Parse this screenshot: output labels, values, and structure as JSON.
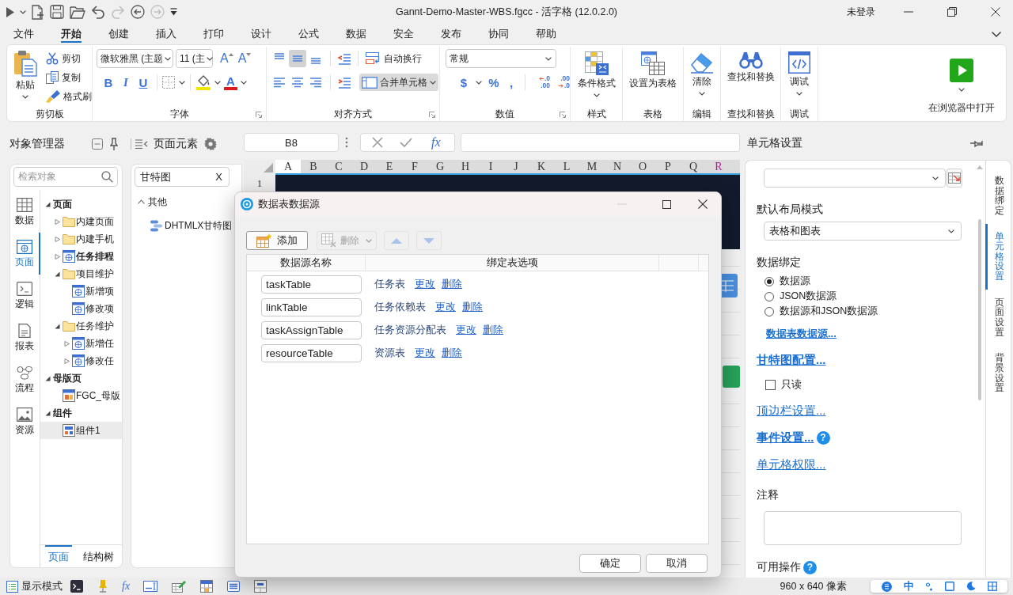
{
  "title_bar": {
    "quick_access": [
      {
        "kind": "run",
        "disabled": false
      },
      {
        "kind": "new",
        "disabled": false
      },
      {
        "kind": "save",
        "disabled": false
      },
      {
        "kind": "open",
        "disabled": false
      },
      {
        "kind": "undo",
        "disabled": false
      },
      {
        "kind": "redo",
        "disabled": true
      },
      {
        "kind": "back",
        "disabled": false
      },
      {
        "kind": "forward",
        "disabled": true
      }
    ],
    "title": "Gannt-Demo-Master-WBS.fgcc - 活字格 (12.0.2.0)",
    "account": "未登录"
  },
  "menu_tabs": [
    {
      "label": "文件",
      "selected": false
    },
    {
      "label": "开始",
      "selected": true
    },
    {
      "label": "创建",
      "selected": false
    },
    {
      "label": "插入",
      "selected": false
    },
    {
      "label": "打印",
      "selected": false
    },
    {
      "label": "设计",
      "selected": false
    },
    {
      "label": "公式",
      "selected": false
    },
    {
      "label": "数据",
      "selected": false
    },
    {
      "label": "安全",
      "selected": false
    },
    {
      "label": "发布",
      "selected": false
    },
    {
      "label": "协同",
      "selected": false
    },
    {
      "label": "帮助",
      "selected": false
    }
  ],
  "ribbon": {
    "groups": [
      {
        "kind": "clipboard",
        "label": "剪切板",
        "paste": "粘贴",
        "actions": [
          {
            "kind": "cut",
            "label": "剪切"
          },
          {
            "kind": "copy",
            "label": "复制"
          },
          {
            "kind": "format-painter",
            "label": "格式刷"
          }
        ]
      },
      {
        "kind": "font",
        "label": "字体",
        "dialog_launcher": true,
        "font": "微软雅黑 (主题",
        "size": "11 (主",
        "grow": "A",
        "shrink": "A",
        "styles": [
          {
            "kind": "bold",
            "label": "B"
          },
          {
            "kind": "italic",
            "label": "I"
          },
          {
            "kind": "underline",
            "label": "U"
          }
        ],
        "font_color": "A"
      },
      {
        "kind": "alignment",
        "label": "对齐方式",
        "dialog_launcher": true,
        "vertical": [
          {
            "kind": "top",
            "selected": false
          },
          {
            "kind": "middle",
            "selected": true
          },
          {
            "kind": "bottom",
            "selected": false
          }
        ],
        "horizontal": [
          {
            "kind": "left",
            "selected": false
          },
          {
            "kind": "center",
            "selected": false
          },
          {
            "kind": "right",
            "selected": false
          }
        ],
        "wrap": {
          "label": "自动换行",
          "on": false
        },
        "merge": {
          "label": "合并单元格",
          "on": true
        }
      },
      {
        "kind": "number",
        "label": "数值",
        "dialog_launcher": true,
        "format": "常规",
        "symbols": [
          {
            "label": "$",
            "dropdown": true
          },
          {
            "label": "%",
            "dropdown": false
          },
          {
            "label": ",",
            "dropdown": false
          }
        ],
        "decimals": [
          {
            "kind": "increase",
            "lines": [
              ".0",
              ".00"
            ]
          },
          {
            "kind": "decrease",
            "lines": [
              ".00",
              ".0"
            ]
          }
        ]
      },
      {
        "kind": "conditional-format",
        "label": "样式",
        "button": "条件格式",
        "dropdown": true
      },
      {
        "kind": "table",
        "label": "表格",
        "button": "设置为表格",
        "dropdown": false
      },
      {
        "kind": "clear",
        "label": "编辑",
        "button": "清除",
        "dropdown": true
      },
      {
        "kind": "find",
        "label": "查找和替换",
        "button": "查找和替换",
        "dropdown": false
      },
      {
        "kind": "debug",
        "label": "调试",
        "button": "调试",
        "dropdown": true
      },
      {
        "kind": "run",
        "button": "在浏览器中打开",
        "dropdown": true
      }
    ]
  },
  "object_manager": {
    "title": "对象管理器",
    "search": {
      "placeholder": "检索对象"
    },
    "nav": [
      {
        "kind": "data",
        "label": "数据",
        "selected": false
      },
      {
        "kind": "page",
        "label": "页面",
        "selected": true
      },
      {
        "kind": "logic",
        "label": "逻辑",
        "selected": false
      },
      {
        "kind": "report",
        "label": "报表",
        "selected": false
      },
      {
        "kind": "flow",
        "label": "流程",
        "selected": false
      },
      {
        "kind": "resource",
        "label": "资源",
        "selected": false
      }
    ],
    "tree": [
      {
        "kind": "section",
        "label": "页面",
        "expanded": true,
        "selected": false,
        "children": [
          {
            "kind": "folder",
            "label": "内建页面",
            "expanded": false,
            "selected": false,
            "emphasized": false
          },
          {
            "kind": "folder",
            "label": "内建手机",
            "expanded": false,
            "selected": false,
            "emphasized": false
          },
          {
            "kind": "page",
            "label": "任务排程",
            "expanded": false,
            "selected": false,
            "emphasized": true
          },
          {
            "kind": "folder",
            "label": "项目维护",
            "expanded": true,
            "selected": false,
            "emphasized": false,
            "children": [
              {
                "kind": "page",
                "label": "新增项",
                "selected": false,
                "emphasized": false
              },
              {
                "kind": "page",
                "label": "修改项",
                "selected": false,
                "emphasized": false
              }
            ]
          },
          {
            "kind": "folder",
            "label": "任务维护",
            "expanded": true,
            "selected": false,
            "emphasized": false,
            "children": [
              {
                "kind": "page",
                "label": "新增任",
                "expanded": false,
                "selected": false,
                "emphasized": false
              },
              {
                "kind": "page",
                "label": "修改任",
                "expanded": false,
                "selected": false,
                "emphasized": false
              }
            ]
          }
        ]
      },
      {
        "kind": "section",
        "label": "母版页",
        "expanded": true,
        "selected": false,
        "children": [
          {
            "kind": "master",
            "label": "FGC_母版",
            "selected": false,
            "emphasized": false
          }
        ]
      },
      {
        "kind": "section",
        "label": "组件",
        "expanded": true,
        "selected": false,
        "children": [
          {
            "kind": "component",
            "label": "组件1",
            "selected": true,
            "emphasized": false
          }
        ]
      }
    ],
    "bottom_tabs": [
      {
        "label": "页面",
        "selected": true
      },
      {
        "label": "结构树",
        "selected": false
      }
    ]
  },
  "page_elements": {
    "title": "页面元素",
    "search": {
      "value": "甘特图",
      "clear": "X"
    },
    "tree": [
      {
        "label": "其他",
        "expanded": true,
        "children": [
          {
            "label": "DHTMLX甘特图"
          }
        ]
      }
    ]
  },
  "sheet": {
    "cell": "B8",
    "function": "fx",
    "columns": [
      {
        "label": "A",
        "selected": true,
        "highlighted": false
      },
      {
        "label": "B",
        "selected": false,
        "highlighted": false
      },
      {
        "label": "C",
        "selected": false,
        "highlighted": false
      },
      {
        "label": "D",
        "selected": false,
        "highlighted": false
      },
      {
        "label": "E",
        "selected": false,
        "highlighted": false
      },
      {
        "label": "F",
        "selected": false,
        "highlighted": false
      },
      {
        "label": "G",
        "selected": false,
        "highlighted": false
      },
      {
        "label": "H",
        "selected": false,
        "highlighted": false
      },
      {
        "label": "I",
        "selected": false,
        "highlighted": false
      },
      {
        "label": "J",
        "selected": false,
        "highlighted": false
      },
      {
        "label": "K",
        "selected": false,
        "highlighted": false
      },
      {
        "label": "L",
        "selected": false,
        "highlighted": false
      },
      {
        "label": "M",
        "selected": false,
        "highlighted": false
      },
      {
        "label": "N",
        "selected": false,
        "highlighted": false
      },
      {
        "label": "O",
        "selected": false,
        "highlighted": false
      },
      {
        "label": "P",
        "selected": false,
        "highlighted": false
      },
      {
        "label": "Q",
        "selected": false,
        "highlighted": false
      },
      {
        "label": "R",
        "selected": false,
        "highlighted": true
      }
    ],
    "rows": [
      "1"
    ]
  },
  "dialog": {
    "title": "数据表数据源",
    "minimize_enabled": false,
    "toolbar": [
      {
        "kind": "add",
        "label": "添加",
        "disabled": false
      },
      {
        "kind": "delete",
        "label": "删除",
        "disabled": true
      },
      {
        "kind": "up",
        "disabled": true
      },
      {
        "kind": "down",
        "disabled": true
      }
    ],
    "columns": [
      "数据源名称",
      "绑定表选项"
    ],
    "rows": [
      {
        "name": "taskTable",
        "table": "任务表",
        "actions": [
          "更改",
          "删除"
        ]
      },
      {
        "name": "linkTable",
        "table": "任务依赖表",
        "actions": [
          "更改",
          "删除"
        ]
      },
      {
        "name": "taskAssignTable",
        "table": "任务资源分配表",
        "actions": [
          "更改",
          "删除"
        ]
      },
      {
        "name": "resourceTable",
        "table": "资源表",
        "actions": [
          "更改",
          "删除"
        ]
      }
    ],
    "buttons": [
      "确定",
      "取消"
    ]
  },
  "cell_settings": {
    "title": "单元格设置",
    "tabs": [
      {
        "label": "数据绑定",
        "selected": false
      },
      {
        "label": "单元格设置",
        "selected": true
      },
      {
        "label": "页面设置",
        "selected": false
      },
      {
        "label": "背景设置",
        "selected": false
      }
    ],
    "items": [
      {
        "kind": "picker-select"
      },
      {
        "kind": "heading",
        "text": "默认布局模式"
      },
      {
        "kind": "select",
        "value": "表格和图表"
      },
      {
        "kind": "heading",
        "text": "数据绑定"
      },
      {
        "kind": "radios",
        "options": [
          {
            "label": "数据源",
            "selected": true
          },
          {
            "label": "JSON数据源",
            "selected": false
          },
          {
            "label": "数据源和JSON数据源",
            "selected": false
          }
        ]
      },
      {
        "kind": "sublink",
        "text": "数据表数据源..."
      },
      {
        "kind": "link",
        "text": "甘特图配置...",
        "bold": true
      },
      {
        "kind": "checkbox",
        "label": "只读",
        "checked": false
      },
      {
        "kind": "link",
        "text": "顶边栏设置...",
        "bold": false
      },
      {
        "kind": "link",
        "text": "事件设置...",
        "bold": true,
        "help": "?"
      },
      {
        "kind": "link",
        "text": "单元格权限...",
        "bold": false
      },
      {
        "kind": "heading",
        "text": "注释"
      },
      {
        "kind": "textarea"
      },
      {
        "kind": "heading",
        "text": "可用操作",
        "help": "?"
      }
    ]
  },
  "status_bar": {
    "mode": "显示模式",
    "function": "fx",
    "size": "960 x 640 像素",
    "input_method": "中"
  }
}
